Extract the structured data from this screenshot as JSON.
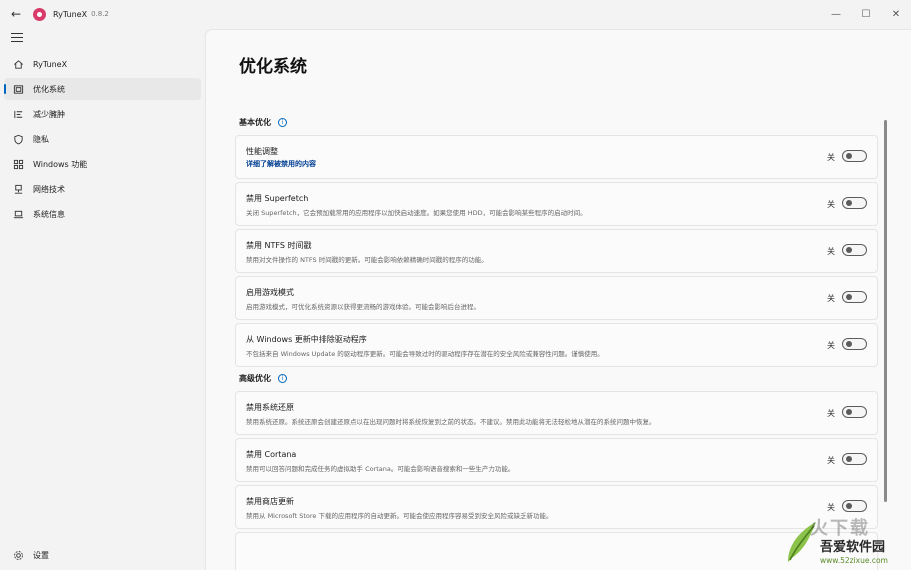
{
  "titlebar": {
    "app_name": "RyTuneX",
    "version": "0.8.2",
    "minimize": "—",
    "maximize": "☐",
    "close": "✕"
  },
  "sidebar": {
    "items": [
      {
        "label": "RyTuneX",
        "icon": "home-icon"
      },
      {
        "label": "优化系统",
        "icon": "optimize-icon",
        "active": true
      },
      {
        "label": "减少臃肿",
        "icon": "list-icon"
      },
      {
        "label": "隐私",
        "icon": "shield-icon"
      },
      {
        "label": "Windows 功能",
        "icon": "apps-icon"
      },
      {
        "label": "网络技术",
        "icon": "network-icon"
      },
      {
        "label": "系统信息",
        "icon": "laptop-icon"
      }
    ],
    "settings_label": "设置"
  },
  "main": {
    "title": "优化系统",
    "sections": [
      {
        "title": "基本优化"
      },
      {
        "title": "高级优化"
      }
    ],
    "toggle_off_label": "关",
    "cards": [
      {
        "title": "性能调整",
        "link": "详细了解被禁用的内容",
        "state": "关"
      },
      {
        "title": "禁用 Superfetch",
        "desc": "关闭 Superfetch，它会预加载常用的应用程序以加快启动速度。如果您使用 HDD，可能会影响某些程序的启动时间。",
        "state": "关"
      },
      {
        "title": "禁用 NTFS 时间戳",
        "desc": "禁用对文件操作的 NTFS 时间戳的更新。可能会影响依赖精确时间戳的程序的功能。",
        "state": "关"
      },
      {
        "title": "启用游戏模式",
        "desc": "启用游戏模式，可优化系统资源以获得更流畅的游戏体验。可能会影响后台进程。",
        "state": "关"
      },
      {
        "title": "从 Windows 更新中排除驱动程序",
        "desc": "不包括来自 Windows Update 的驱动程序更新。可能会导致过时的驱动程序存在潜在的安全风险或兼容性问题。谨慎使用。",
        "state": "关"
      },
      {
        "title": "禁用系统还原",
        "desc": "禁用系统还原。系统还原会创建还原点以在出现问题时将系统恢复到之前的状态。不建议。禁用此功能将无法轻松地从潜在的系统问题中恢复。",
        "state": "关"
      },
      {
        "title": "禁用 Cortana",
        "desc": "禁用可以回答问题和完成任务的虚拟助手 Cortana。可能会影响语音搜索和一些生产力功能。",
        "state": "关"
      },
      {
        "title": "禁用商店更新",
        "desc": "禁用从 Microsoft Store 下载的应用程序的自动更新。可能会使应用程序容易受到安全风险或缺乏新功能。",
        "state": "关"
      }
    ]
  },
  "watermark": {
    "top": "火下载",
    "main": "吾爱软件园",
    "url": "www.52zixue.com"
  },
  "colors": {
    "accent": "#0067c0",
    "background": "#f3f3f3",
    "card": "#fbfbfb"
  }
}
